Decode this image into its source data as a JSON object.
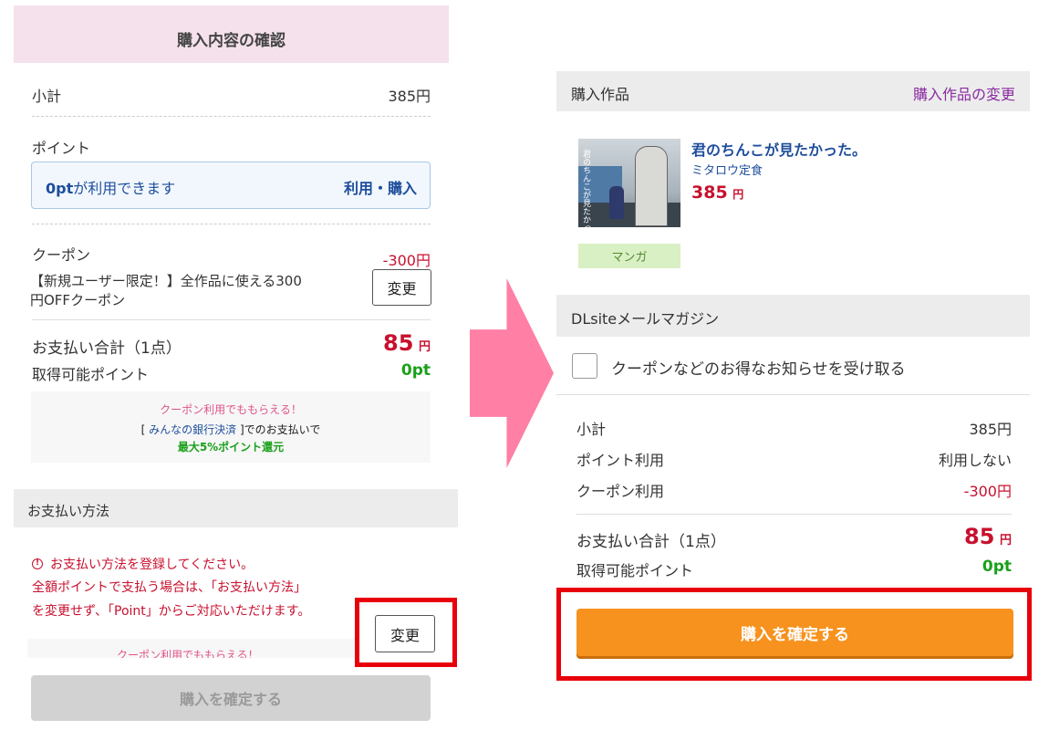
{
  "left": {
    "header_title": "購入内容の確認",
    "subtotal": {
      "label": "小計",
      "value": "385円"
    },
    "point": {
      "label": "ポイント",
      "available_highlight": "0pt",
      "available_text": "が利用できます",
      "action": "利用・購入"
    },
    "coupon": {
      "label": "クーポン",
      "amount": "-300円",
      "desc_line1": "【新規ユーザー限定！】全作品に使える300",
      "desc_line2": "円OFFクーポン",
      "change_label": "変更"
    },
    "total": {
      "label": "お支払い合計（1点）",
      "value": "85",
      "unit": "円",
      "points_label": "取得可能ポイント",
      "points_value": "0pt"
    },
    "promo": {
      "line1": "クーポン利用でももらえる！",
      "line2_prefix": "[ ",
      "line2_link": "みんなの銀行決済",
      "line2_suffix": " ]でのお支払いで",
      "line3": "最大5%ポイント還元"
    },
    "payment": {
      "header": "お支払い方法",
      "warn_line1": "お支払い方法を登録してください。",
      "warn_line2": "全額ポイントで支払う場合は、「お支払い方法」",
      "warn_line3": "を変更せず、「Point」からご対応いただけます。",
      "change_label": "変更",
      "promo_partial": "クーポン利用でももらえる！"
    },
    "confirm_label": "購入を確定する"
  },
  "right": {
    "work_header": {
      "label": "購入作品",
      "change_link": "購入作品の変更"
    },
    "product": {
      "title": "君のちんこが見たかった。",
      "author": "ミタロウ定食",
      "price": "385",
      "price_unit": "円",
      "genre": "マンガ",
      "cover_text": "君のちんこが見たかった"
    },
    "newsletter": {
      "header": "DLsiteメールマガジン",
      "checkbox_label": "クーポンなどのお得なお知らせを受け取る"
    },
    "summary": {
      "subtotal_label": "小計",
      "subtotal_value": "385円",
      "point_label": "ポイント利用",
      "point_value": "利用しない",
      "coupon_label": "クーポン利用",
      "coupon_value": "-300円",
      "total_label": "お支払い合計（1点）",
      "total_value": "85",
      "total_unit": "円",
      "points_label": "取得可能ポイント",
      "points_value": "0pt"
    },
    "confirm_label": "購入を確定する"
  },
  "colors": {
    "pink_header": "#f5e1eb",
    "arrow": "#ff7fa5",
    "price_red": "#c8102e",
    "green": "#1aa01a",
    "orange": "#f7921e",
    "highlight_red": "#e8000b",
    "blue": "#1f4e9c"
  },
  "icons": {
    "arrow": "right-arrow-icon",
    "warning": "warning-circle-icon",
    "checkbox": "checkbox-icon"
  }
}
